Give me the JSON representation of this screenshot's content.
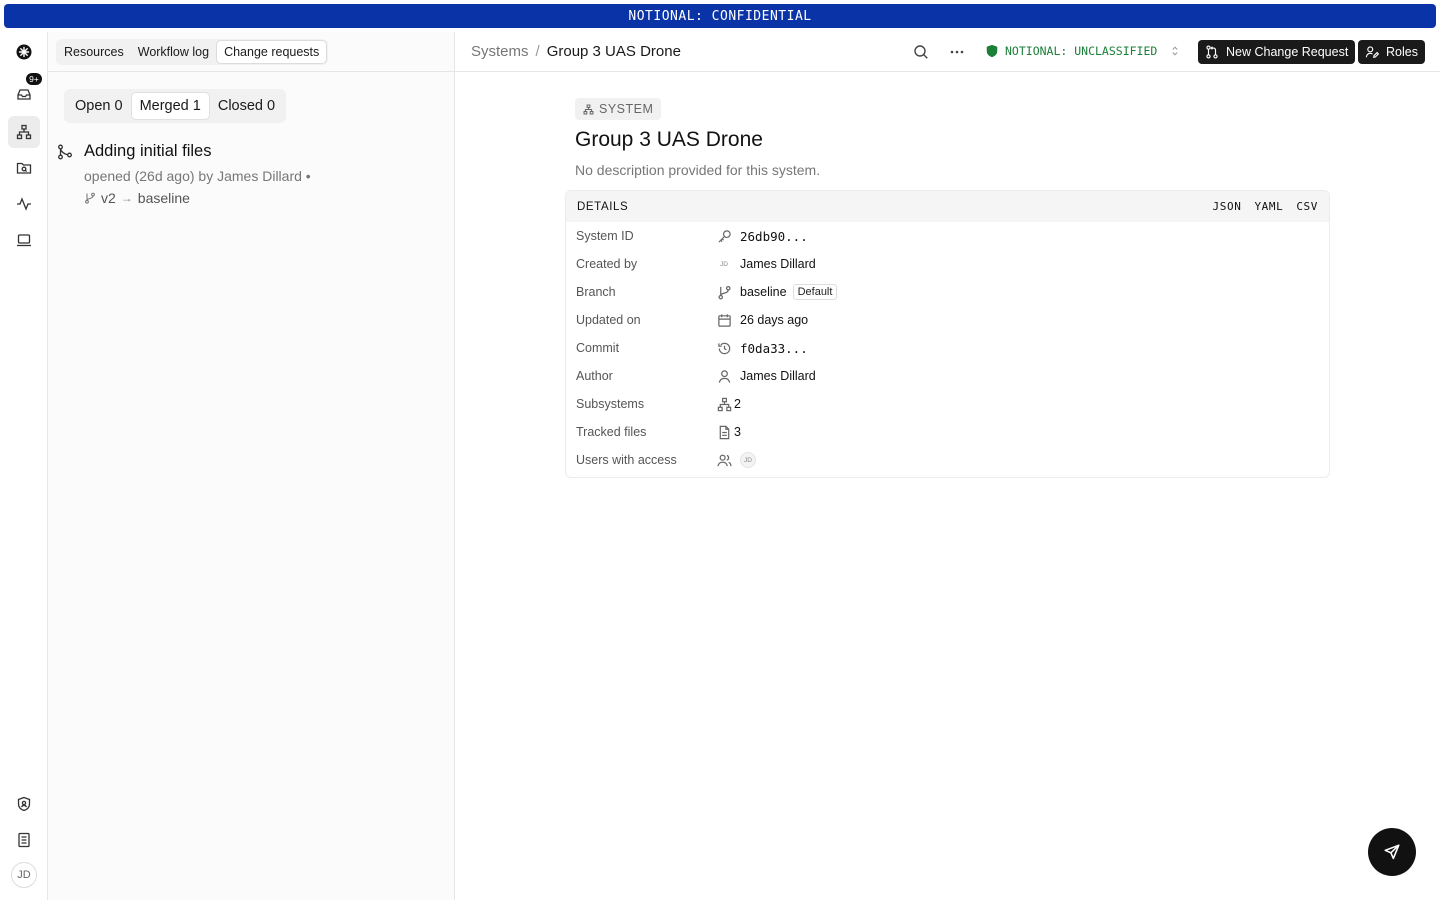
{
  "banner": {
    "text": "NOTIONAL: CONFIDENTIAL"
  },
  "rail": {
    "notifications_badge": "9+",
    "user_initials": "JD"
  },
  "left": {
    "tabs": [
      {
        "label": "Resources"
      },
      {
        "label": "Workflow log"
      },
      {
        "label": "Change requests",
        "active": true
      }
    ],
    "status_tabs": [
      {
        "label": "Open 0"
      },
      {
        "label": "Merged 1",
        "active": true
      },
      {
        "label": "Closed 0"
      }
    ],
    "change_request": {
      "title": "Adding initial files",
      "meta": "opened (26d ago) by James Dillard  •",
      "source_branch": "v2",
      "arrow": "→",
      "target_branch": "baseline"
    }
  },
  "header": {
    "breadcrumb_root": "Systems",
    "breadcrumb_sep": "/",
    "breadcrumb_current": "Group 3 UAS Drone",
    "classification": "NOTIONAL: UNCLASSIFIED",
    "classification_color": "#1a7f37",
    "new_cr_label": "New Change Request",
    "roles_label": "Roles"
  },
  "main": {
    "chip": "SYSTEM",
    "title": "Group 3 UAS Drone",
    "description": "No description provided for this system.",
    "details": {
      "heading": "DETAILS",
      "formats": [
        "JSON",
        "YAML",
        "CSV"
      ],
      "system_id": {
        "label": "System ID",
        "value": "26db90..."
      },
      "created_by": {
        "label": "Created by",
        "initials": "JD",
        "value": "James Dillard"
      },
      "branch": {
        "label": "Branch",
        "value": "baseline",
        "badge": "Default"
      },
      "updated_on": {
        "label": "Updated on",
        "value": "26 days ago"
      },
      "commit": {
        "label": "Commit",
        "value": "f0da33..."
      },
      "author": {
        "label": "Author",
        "value": "James Dillard"
      },
      "subsystems": {
        "label": "Subsystems",
        "value": "2"
      },
      "tracked_files": {
        "label": "Tracked files",
        "value": "3"
      },
      "users_with_access": {
        "label": "Users with access",
        "initials": "JD"
      }
    }
  },
  "colors": {
    "banner": "#0a33a8",
    "accent_dark": "#1a1a1a"
  }
}
